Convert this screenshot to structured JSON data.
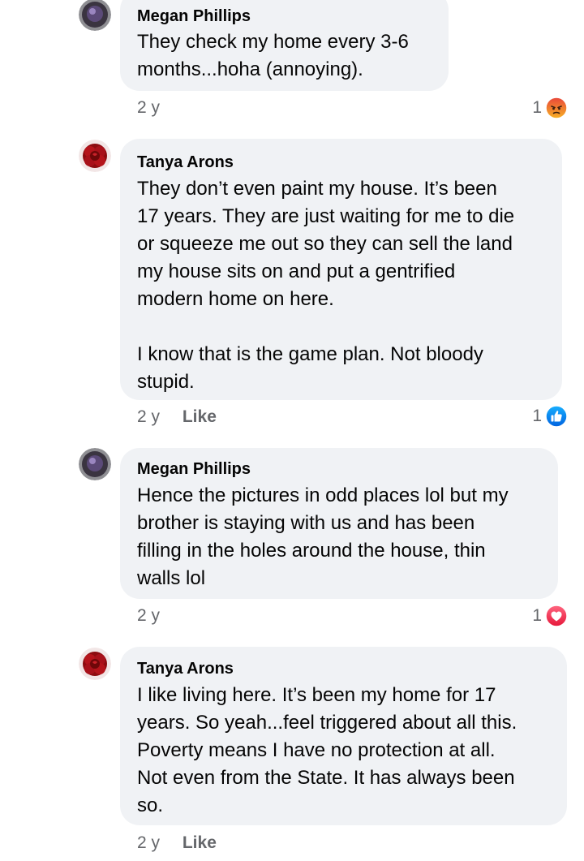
{
  "comments": [
    {
      "author": "Megan Phillips",
      "text": "They check my home every 3-6\nmonths...hoha (annoying).",
      "time": "2 y",
      "like_label": "",
      "reaction": {
        "count": "1",
        "icon": "angry-reaction-icon",
        "color": "#f0642a"
      }
    },
    {
      "author": "Tanya Arons",
      "text": "They don’t even paint my house.  It’s been\n17 years.  They are just waiting for me to die\nor squeeze me out so they can sell the land\nmy house sits on and put a gentrified\nmodern home on here.\n\nI know that is the game plan.  Not bloody\nstupid.",
      "time": "2 y",
      "like_label": "Like",
      "reaction": {
        "count": "1",
        "icon": "like-reaction-icon",
        "color": "#1877f2"
      }
    },
    {
      "author": "Megan Phillips",
      "text": "Hence the pictures in odd places lol but my\nbrother is staying with us and has been\nfilling in the holes around the house, thin\nwalls lol",
      "time": "2 y",
      "like_label": "",
      "reaction": {
        "count": "1",
        "icon": "love-reaction-icon",
        "color": "#f33e58"
      }
    },
    {
      "author": "Tanya Arons",
      "text": "I like living here.  It’s been my home for 17\nyears.  So yeah...feel triggered about all this.\nPoverty means I have no protection at all.\nNot even from the State.  It has always been\nso.",
      "time": "2 y",
      "like_label": "Like",
      "reaction": null
    }
  ],
  "colors": {
    "bubble": "#f0f2f5",
    "meta_text": "#65676b"
  }
}
